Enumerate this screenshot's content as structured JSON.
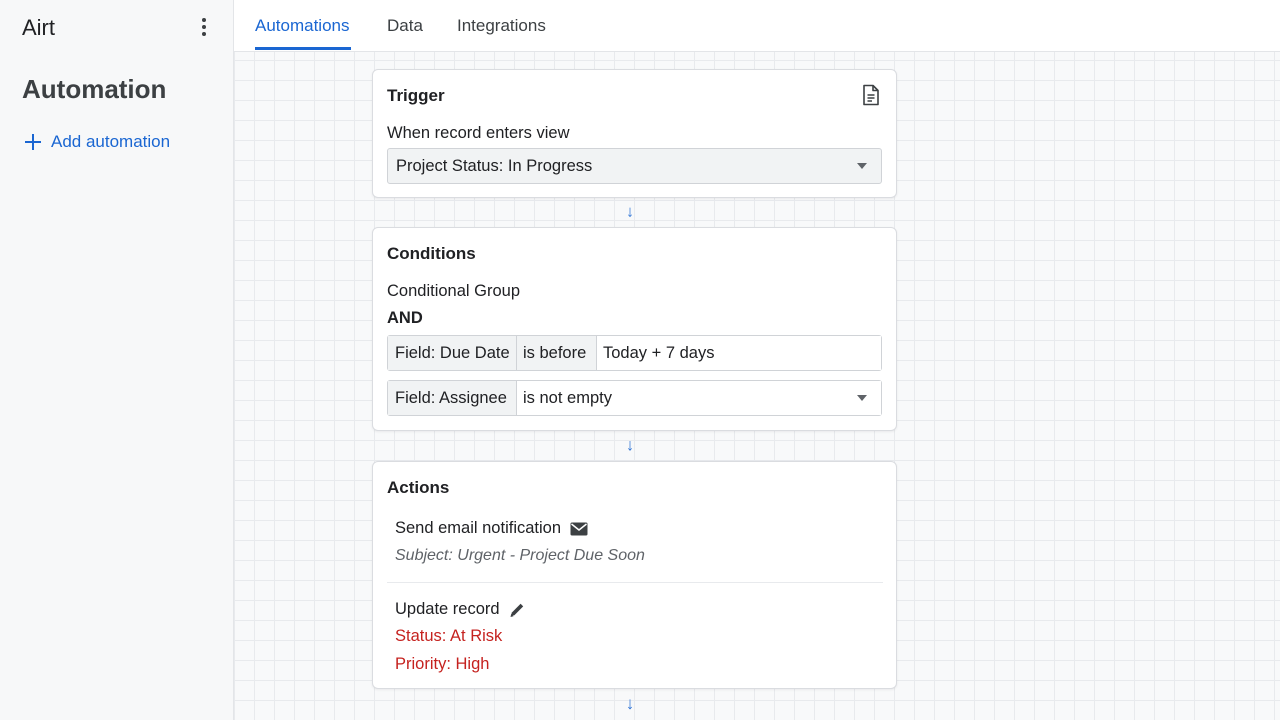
{
  "app": {
    "name": "Airt"
  },
  "sidebar": {
    "title": "Automation",
    "add_label": "Add automation"
  },
  "tabs": [
    {
      "label": "Automations",
      "active": true
    },
    {
      "label": "Data",
      "active": false
    },
    {
      "label": "Integrations",
      "active": false
    }
  ],
  "trigger": {
    "title": "Trigger",
    "when_label": "When record enters view",
    "view_value": "Project Status: In Progress"
  },
  "conditions": {
    "title": "Conditions",
    "group_label": "Conditional Group",
    "operator": "AND",
    "rows": [
      {
        "field": "Field: Due Date",
        "op": "is before",
        "value": "Today + 7 days"
      },
      {
        "field": "Field: Assignee",
        "op": "is not empty",
        "value": ""
      }
    ]
  },
  "actions": {
    "title": "Actions",
    "items": [
      {
        "name": "Send email notification",
        "detail": "Subject: Urgent - Project Due Soon",
        "icon": "envelope-icon"
      },
      {
        "name": "Update record",
        "icon": "pencil-icon",
        "fields": [
          "Status: At Risk",
          "Priority: High"
        ]
      }
    ]
  },
  "colors": {
    "accent": "#1a66d2",
    "danger": "#c5221f"
  }
}
